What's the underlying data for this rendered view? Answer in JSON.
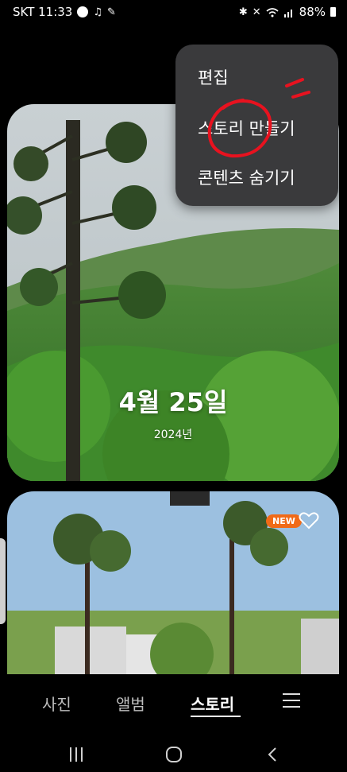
{
  "status_bar": {
    "carrier_time": "SKT 11:33",
    "battery": "88%"
  },
  "menu": {
    "items": [
      {
        "label": "편집"
      },
      {
        "label": "스토리 만들기"
      },
      {
        "label": "콘텐츠 숨기기"
      }
    ],
    "annotation_color": "#e8121f"
  },
  "stories": [
    {
      "date": "4월 25일",
      "year": "2024년"
    },
    {
      "badge": "NEW"
    }
  ],
  "tabs": [
    {
      "label": "사진",
      "active": false
    },
    {
      "label": "앨범",
      "active": false
    },
    {
      "label": "스토리",
      "active": true
    }
  ],
  "colors": {
    "menu_bg": "#3a3a3c",
    "badge": "#f06a17"
  }
}
